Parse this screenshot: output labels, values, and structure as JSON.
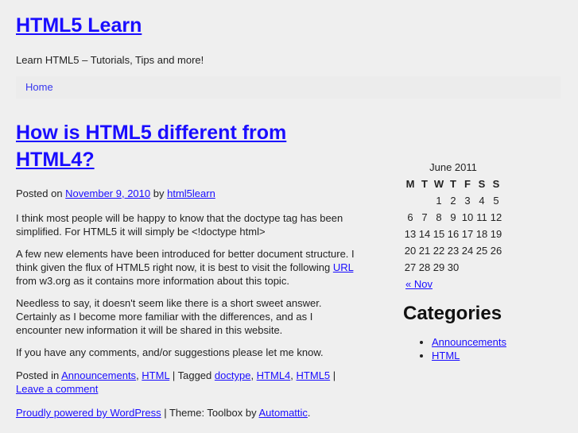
{
  "header": {
    "site_title": "HTML5 Learn",
    "site_description": "Learn HTML5 – Tutorials, Tips and more!"
  },
  "nav": {
    "items": [
      {
        "label": "Home"
      }
    ]
  },
  "post": {
    "title": "How is HTML5 different from HTML4?",
    "meta": {
      "posted_on_label": "Posted on",
      "date": "November 9, 2010",
      "by_label": "by",
      "author": "html5learn"
    },
    "paragraphs": {
      "p1": "I think most people will be happy to know that the doctype tag has been simplified. For HTML5 it will simply be <!doctype html>",
      "p2_before_link": "A few new elements have been introduced for better document structure. I think given the flux of HTML5 right now, it is best to visit the following ",
      "p2_link": "URL",
      "p2_after_link": " from w3.org as it contains more information about this topic.",
      "p3": "Needless to say, it doesn't seem like there is a short sweet answer. Certainly as I become more familiar with the differences, and as I encounter new information it will be shared in this website.",
      "p4": "If you have any comments, and/or suggestions please let me know."
    },
    "utility": {
      "posted_in_label": "Posted in",
      "categories": [
        "Announcements",
        "HTML"
      ],
      "separator": "|",
      "tagged_label": "Tagged",
      "tags": [
        "doctype",
        "HTML4",
        "HTML5"
      ],
      "comment_link": "Leave a comment"
    }
  },
  "footer": {
    "powered_by": "Proudly powered by WordPress",
    "separator": "|",
    "theme_label": "Theme: Toolbox by",
    "theme_author": "Automattic",
    "period": "."
  },
  "sidebar": {
    "calendar": {
      "caption": "June 2011",
      "weekdays": [
        "M",
        "T",
        "W",
        "T",
        "F",
        "S",
        "S"
      ],
      "weeks": [
        [
          "",
          "",
          "1",
          "2",
          "3",
          "4",
          "5"
        ],
        [
          "6",
          "7",
          "8",
          "9",
          "10",
          "11",
          "12"
        ],
        [
          "13",
          "14",
          "15",
          "16",
          "17",
          "18",
          "19"
        ],
        [
          "20",
          "21",
          "22",
          "23",
          "24",
          "25",
          "26"
        ],
        [
          "27",
          "28",
          "29",
          "30",
          "",
          "",
          ""
        ]
      ],
      "prev_link": "« Nov"
    },
    "categories": {
      "title": "Categories",
      "items": [
        "Announcements",
        "HTML"
      ]
    }
  }
}
